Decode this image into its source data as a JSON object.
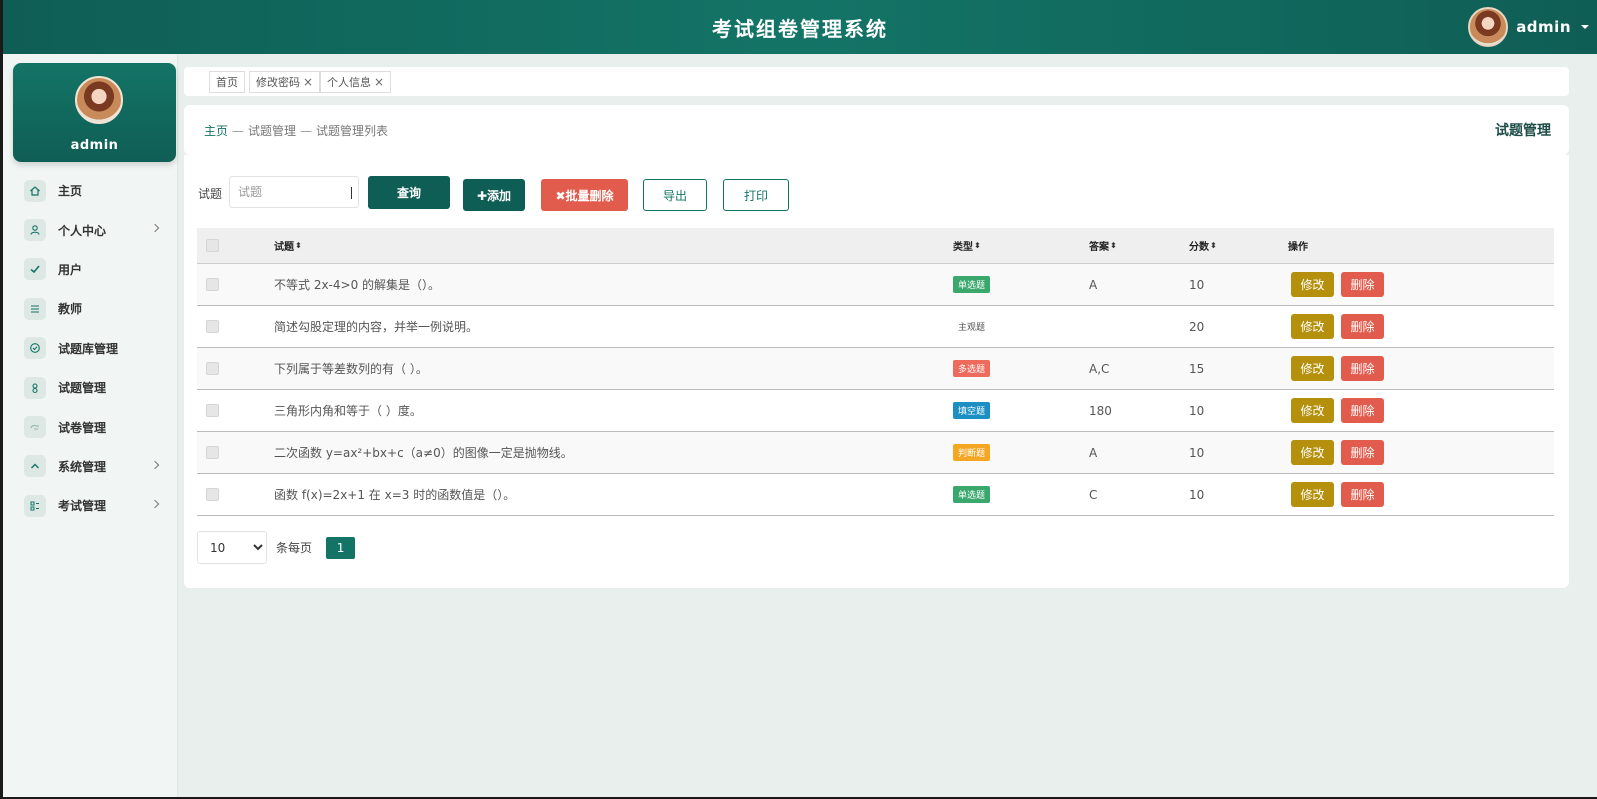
{
  "header": {
    "title": "考试组卷管理系统",
    "user_name": "admin"
  },
  "sidebar": {
    "profile_name": "admin",
    "items": [
      {
        "label": "主页",
        "icon": "home-icon",
        "has_arrow": false
      },
      {
        "label": "个人中心",
        "icon": "person-icon",
        "has_arrow": true
      },
      {
        "label": "用户",
        "icon": "check-icon",
        "has_arrow": false
      },
      {
        "label": "教师",
        "icon": "list-icon",
        "has_arrow": false
      },
      {
        "label": "试题库管理",
        "icon": "circle-check-icon",
        "has_arrow": false
      },
      {
        "label": "试题管理",
        "icon": "tag-icon",
        "has_arrow": false
      },
      {
        "label": "试卷管理",
        "icon": "hand-icon",
        "has_arrow": false
      },
      {
        "label": "系统管理",
        "icon": "chevron-up-icon",
        "has_arrow": true
      },
      {
        "label": "考试管理",
        "icon": "grid-icon",
        "has_arrow": true
      }
    ]
  },
  "tabs": [
    {
      "label": "首页",
      "closable": false
    },
    {
      "label": "修改密码",
      "closable": true,
      "close": "×"
    },
    {
      "label": "个人信息",
      "closable": true,
      "close": "×"
    }
  ],
  "breadcrumb": {
    "home": "主页",
    "sep": "—",
    "level2": "试题管理",
    "level3": "试题管理列表",
    "title": "试题管理"
  },
  "search": {
    "label": "试题",
    "placeholder": "试题",
    "value": ""
  },
  "toolbar": {
    "query": "查询",
    "add": "✚添加",
    "batch_delete": "✖批量删除",
    "export": "导出",
    "print": "打印"
  },
  "table": {
    "headers": {
      "question": "试题",
      "type": "类型",
      "answer": "答案",
      "score": "分数",
      "ops": "操作",
      "sort": "⬍"
    },
    "rows": [
      {
        "question": "不等式 2x-4>0 的解集是（）。",
        "type": "单选题",
        "type_color": "#3aa76d",
        "answer": "A",
        "score": "10"
      },
      {
        "question": "简述勾股定理的内容，并举一例说明。",
        "type": "主观题",
        "type_color": "",
        "answer": "",
        "score": "20"
      },
      {
        "question": "下列属于等差数列的有（ ）。",
        "type": "多选题",
        "type_color": "#ee6a5d",
        "answer": "A,C",
        "score": "15"
      },
      {
        "question": "三角形内角和等于（ ）度。",
        "type": "填空题",
        "type_color": "#1b8fc4",
        "answer": "180",
        "score": "10"
      },
      {
        "question": "二次函数 y=ax²+bx+c（a≠0）的图像一定是抛物线。",
        "type": "判断题",
        "type_color": "#f5a623",
        "answer": "A",
        "score": "10"
      },
      {
        "question": "函数 f(x)=2x+1 在 x=3 时的函数值是（）。",
        "type": "单选题",
        "type_color": "#3aa76d",
        "answer": "C",
        "score": "10"
      }
    ],
    "edit_label": "修改",
    "delete_label": "删除"
  },
  "pagination": {
    "page_size": "10",
    "page_size_options": [
      "10"
    ],
    "per_page_label": "条每页",
    "current_page": "1"
  },
  "colors": {
    "primary": "#137466",
    "primary_dark": "#0f5e55",
    "danger": "#e25c4e",
    "warning": "#b4900c"
  }
}
